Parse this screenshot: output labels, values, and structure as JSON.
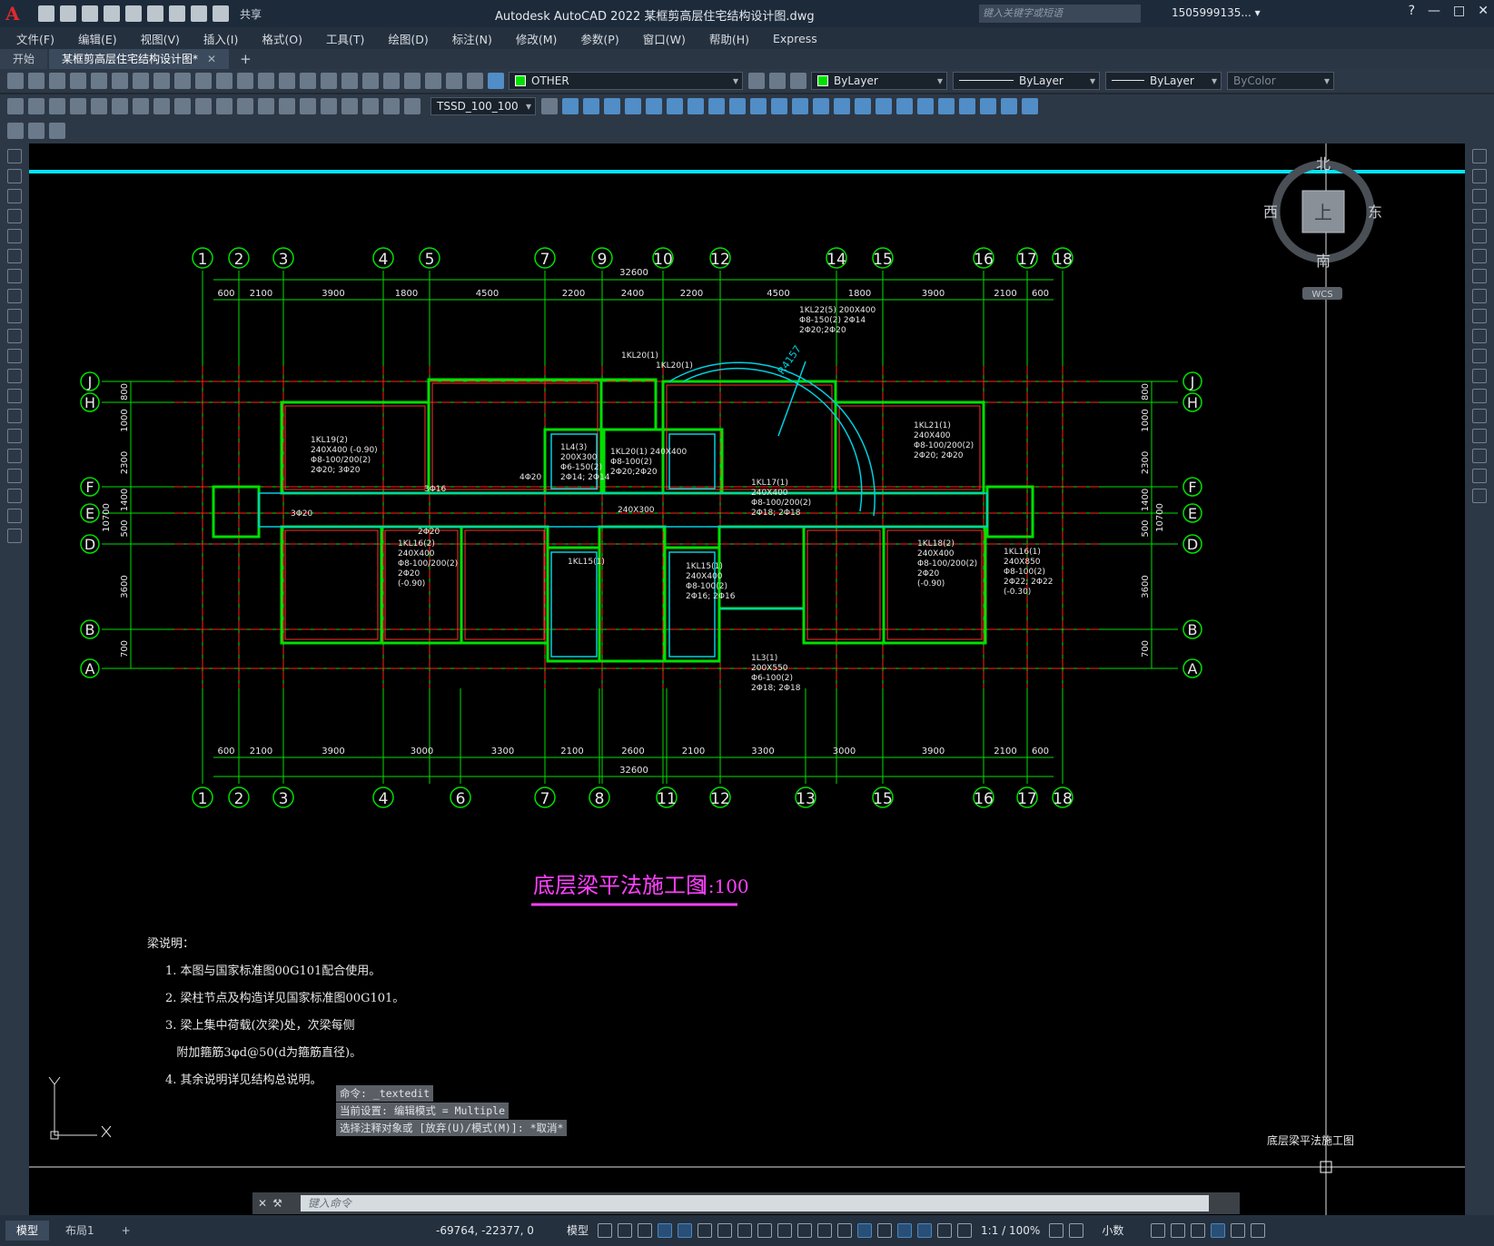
{
  "app": {
    "title": "Autodesk AutoCAD 2022    某框剪高层住宅结构设计图.dwg",
    "search_placeholder": "键入关键字或短语",
    "user": "1505999135... ▾",
    "share": "共享"
  },
  "menu": [
    "文件(F)",
    "编辑(E)",
    "视图(V)",
    "插入(I)",
    "格式(O)",
    "工具(T)",
    "绘图(D)",
    "标注(N)",
    "修改(M)",
    "参数(P)",
    "窗口(W)",
    "帮助(H)",
    "Express"
  ],
  "tabs": [
    {
      "label": "开始"
    },
    {
      "label": "某框剪高层住宅结构设计图*"
    }
  ],
  "toolbar": {
    "layer": "OTHER",
    "color": "ByLayer",
    "linetype": "ByLayer",
    "lineweight": "ByLayer",
    "plotstyle": "ByColor",
    "dimstyle": "TSSD_100_100"
  },
  "viewcube": {
    "north": "北",
    "south": "南",
    "east": "东",
    "west": "西",
    "top": "上",
    "wcs": "WCS"
  },
  "drawing": {
    "title": "底层梁平法施工图",
    "scale": "1:100",
    "corner_label": "底层梁平法施工图",
    "notes_title": "梁说明：",
    "notes": [
      "1. 本图与国家标准图00G101配合使用。",
      "2. 梁柱节点及构造详见国家标准图00G101。",
      "3. 梁上集中荷载(次梁)处，次梁每侧",
      "   附加箍筋3φd@50(d为箍筋直径)。",
      "4. 其余说明详见结构总说明。"
    ],
    "top_axes": [
      "1",
      "2",
      "3",
      "4",
      "5",
      "7",
      "9",
      "10",
      "12",
      "14",
      "15",
      "16",
      "17",
      "18"
    ],
    "bottom_axes": [
      "1",
      "2",
      "3",
      "4",
      "6",
      "7",
      "8",
      "11",
      "12",
      "13",
      "15",
      "16",
      "17",
      "18"
    ],
    "row_axes": [
      "J",
      "H",
      "F",
      "E",
      "D",
      "B",
      "A"
    ],
    "top_total": "32600",
    "top_dims": [
      "600",
      "2100",
      "3900",
      "1800",
      "4500",
      "2200",
      "2400",
      "2200",
      "4500",
      "1800",
      "3900",
      "2100",
      "600"
    ],
    "bottom_total": "32600",
    "bottom_dims": [
      "600",
      "2100",
      "3900",
      "3000",
      "3300",
      "2100",
      "2600",
      "2100",
      "3300",
      "3000",
      "3900",
      "2100",
      "600"
    ],
    "side_dims": [
      "800",
      "1000",
      "2300",
      "1400",
      "500",
      "3600",
      "700"
    ],
    "side_total": "10700",
    "radius": "R4157",
    "beam_labels": [
      {
        "t": "1KL22(5) 200X400"
      },
      {
        "t": "Φ8-150(2) 2Φ14"
      },
      {
        "t": "2Φ20;2Φ20"
      },
      {
        "t": "1KL20(1)"
      },
      {
        "t": "1KL20(1)"
      },
      {
        "t": "1KL19(2)"
      },
      {
        "t": "240X400 (-0.90)"
      },
      {
        "t": "Φ8-100/200(2)"
      },
      {
        "t": "2Φ20; 3Φ20"
      },
      {
        "t": "1KL21(1)"
      },
      {
        "t": "240X400"
      },
      {
        "t": "Φ8-100/200(2)"
      },
      {
        "t": "2Φ20; 2Φ20"
      },
      {
        "t": "1L4(3)"
      },
      {
        "t": "200X300"
      },
      {
        "t": "Φ6-150(2)"
      },
      {
        "t": "2Φ14; 2Φ14"
      },
      {
        "t": "1KL20(1) 240X400"
      },
      {
        "t": "Φ8-100(2)"
      },
      {
        "t": "2Φ20;2Φ20"
      },
      {
        "t": "1KL17(1)"
      },
      {
        "t": "240X400"
      },
      {
        "t": "Φ8-100/200(2)"
      },
      {
        "t": "2Φ18; 2Φ18"
      },
      {
        "t": "1KL16(2)"
      },
      {
        "t": "240X400"
      },
      {
        "t": "Φ8-100/200(2)"
      },
      {
        "t": "2Φ20"
      },
      {
        "t": "(-0.90)"
      },
      {
        "t": "1KL18(2)"
      },
      {
        "t": "240X400"
      },
      {
        "t": "Φ8-100/200(2)"
      },
      {
        "t": "2Φ20"
      },
      {
        "t": "(-0.90)"
      },
      {
        "t": "1KL16(1)"
      },
      {
        "t": "240X850"
      },
      {
        "t": "Φ8-100(2)"
      },
      {
        "t": "2Φ22; 2Φ22"
      },
      {
        "t": "(-0.30)"
      },
      {
        "t": "1KL15(1)"
      },
      {
        "t": "1KL15(1)"
      },
      {
        "t": "240X400"
      },
      {
        "t": "Φ8-100(2)"
      },
      {
        "t": "2Φ16; 2Φ16"
      },
      {
        "t": "1L3(1)"
      },
      {
        "t": "200X550"
      },
      {
        "t": "Φ6-100(2)"
      },
      {
        "t": "2Φ18; 2Φ18"
      },
      {
        "t": "240X300"
      },
      {
        "t": "3Φ20"
      },
      {
        "t": "2Φ20"
      },
      {
        "t": "3Φ16"
      },
      {
        "t": "4Φ20"
      }
    ]
  },
  "command": {
    "history": [
      "命令: _textedit",
      "当前设置: 编辑模式 = Multiple",
      "选择注释对象或 [放弃(U)/模式(M)]: *取消*"
    ],
    "placeholder": "键入命令"
  },
  "status": {
    "layout_tabs": [
      "模型",
      "布局1"
    ],
    "coords": "-69764, -22377, 0",
    "model": "模型",
    "scale": "1:1 / 100%",
    "units": "小数"
  }
}
